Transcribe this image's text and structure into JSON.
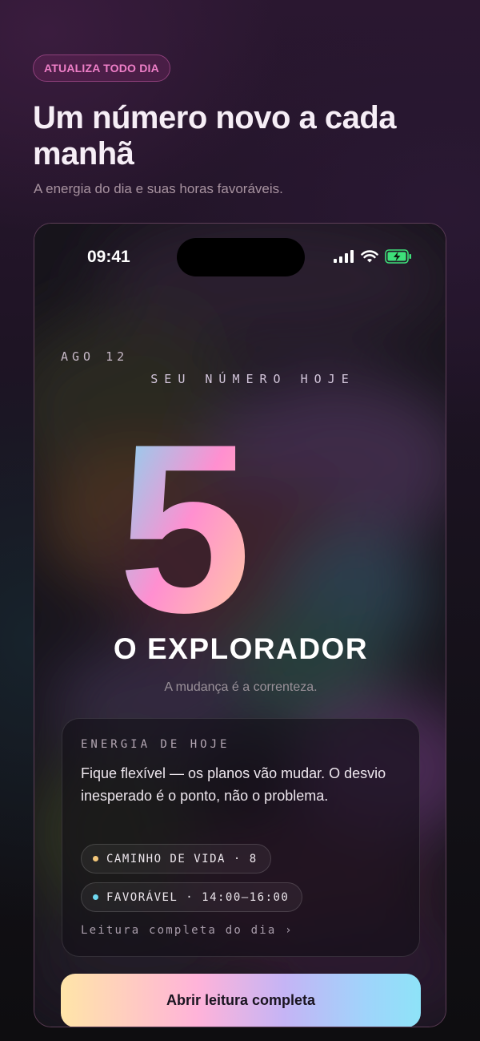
{
  "header": {
    "badge": "ATUALIZA TODO DIA",
    "title": "Um número novo a cada manhã",
    "subtitle": "A energia do dia e suas horas favoráveis."
  },
  "status_bar": {
    "time": "09:41",
    "icons": [
      "signal-icon",
      "wifi-icon",
      "battery-charging-icon"
    ]
  },
  "today": {
    "date": "AGO 12",
    "label": "SEU NÚMERO HOJE",
    "number": "5",
    "archetype": "O EXPLORADOR",
    "tagline": "A mudança é a correnteza."
  },
  "energy_card": {
    "label": "ENERGIA DE HOJE",
    "text": "Fique flexível — os planos vão mudar. O desvio inesperado é o ponto, não o problema.",
    "chips": [
      {
        "text": "CAMINHO DE VIDA · 8",
        "dot_color": "#f3c77a"
      },
      {
        "text": "FAVORÁVEL · 14:00–16:00",
        "dot_color": "#6fd8f0"
      }
    ],
    "link": "Leitura completa do dia ›"
  },
  "cta": {
    "label": "Abrir leitura completa"
  },
  "colors": {
    "badge_text": "#ef7fc8",
    "gradient": [
      "#6fe3f7",
      "#ff8fd0",
      "#ffd59a"
    ]
  }
}
